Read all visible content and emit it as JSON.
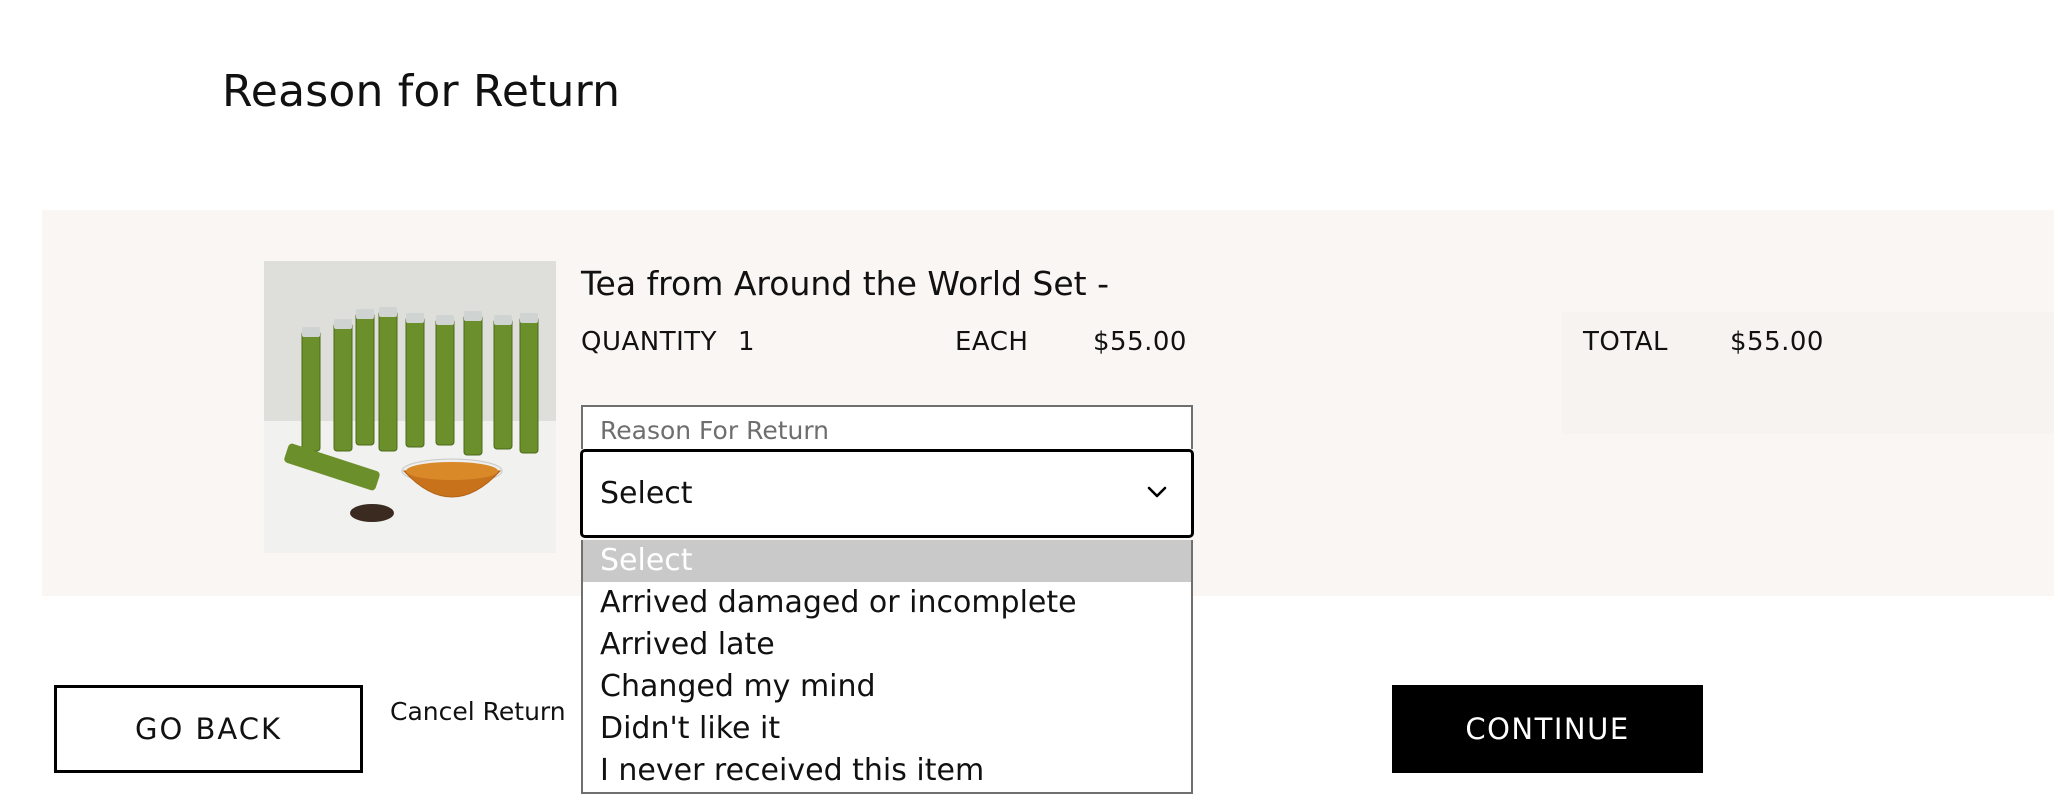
{
  "page": {
    "title": "Reason for Return"
  },
  "item": {
    "name": "Tea from Around the World Set -",
    "quantity_label": "QUANTITY",
    "quantity_value": "1",
    "each_label": "EACH",
    "each_value": "$55.00",
    "total_label": "TOTAL",
    "total_value": "$55.00"
  },
  "reason": {
    "label": "Reason For Return",
    "selected": "Select",
    "options": [
      "Select",
      "Arrived damaged or incomplete",
      "Arrived late",
      "Changed my mind",
      "Didn't like it",
      "I never received this item"
    ]
  },
  "actions": {
    "back_label": "GO BACK",
    "cancel_label": "Cancel Return",
    "continue_label": "CONTINUE"
  },
  "colors": {
    "panel_bg": "#f9f6f3",
    "primary_button": "#000000",
    "selected_option": "#c9c9c9"
  },
  "icons": {
    "select_chevron": "chevron-down-icon"
  }
}
